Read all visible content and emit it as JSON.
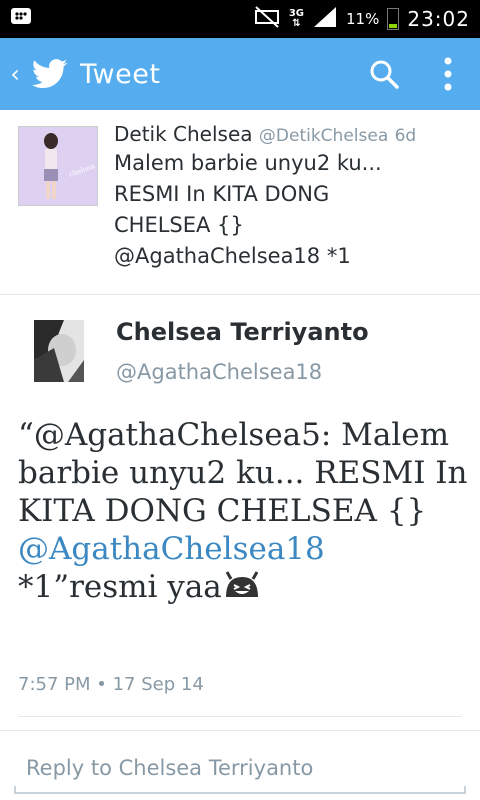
{
  "status_bar": {
    "network": "3G",
    "battery": "11%",
    "time": "23:02",
    "battery_level": 0.11,
    "battery_color": "#8fd400"
  },
  "app_bar": {
    "title": "Tweet",
    "back_icon": "chevron-left-icon",
    "logo_icon": "twitter-bird-icon",
    "search_icon": "search-icon",
    "menu_icon": "more-vert-icon",
    "color": "#55acee"
  },
  "parent_tweet": {
    "name": "Detik Chelsea",
    "handle": "@DetikChelsea",
    "time": "6d",
    "lines": [
      "Malem barbie unyu2 ku...",
      "RESMI In KITA DONG",
      "CHELSEA {}",
      "@AgathaChelsea18 *1"
    ]
  },
  "tweet": {
    "name": "Chelsea Terriyanto",
    "handle": "@AgathaChelsea18",
    "text_before": "“@AgathaChelsea5: Malem barbie unyu2 ku... RESMI In KITA DONG CHELSEA {}",
    "mention": "@AgathaChelsea18",
    "text_after": "*1”resmi yaa",
    "timestamp": "7:57 PM • 17 Sep 14",
    "link_color": "#3b88c3"
  },
  "reply": {
    "placeholder": "Reply to Chelsea Terriyanto"
  }
}
